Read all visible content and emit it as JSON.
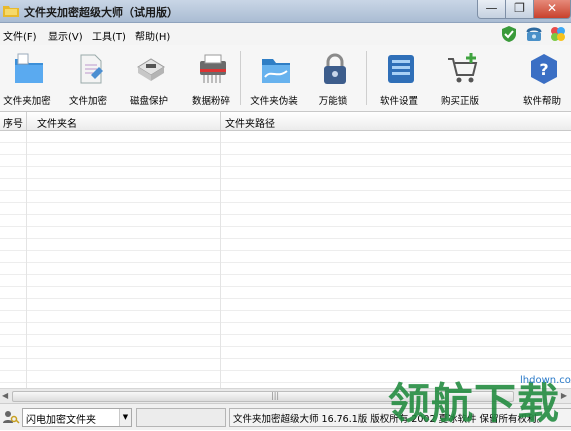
{
  "window": {
    "title": "文件夹加密超级大师（试用版）"
  },
  "menu": {
    "file": "文件(F)",
    "view": "显示(V)",
    "tools": "工具(T)",
    "help": "帮助(H)"
  },
  "toolbar": {
    "items": [
      {
        "label": "文件夹加密",
        "icon": "folder-lock-icon"
      },
      {
        "label": "文件加密",
        "icon": "file-lock-icon"
      },
      {
        "label": "磁盘保护",
        "icon": "disk-protect-icon"
      },
      {
        "label": "数据粉碎",
        "icon": "shredder-icon"
      },
      {
        "label": "文件夹伪装",
        "icon": "folder-disguise-icon"
      },
      {
        "label": "万能锁",
        "icon": "padlock-icon"
      },
      {
        "label": "软件设置",
        "icon": "settings-icon"
      },
      {
        "label": "购买正版",
        "icon": "cart-icon"
      },
      {
        "label": "软件帮助",
        "icon": "help-icon"
      }
    ]
  },
  "list": {
    "columns": [
      "序号",
      "文件夹名",
      "文件夹路径"
    ],
    "rows": []
  },
  "status": {
    "select_value": "闪电加密文件夹",
    "copyright": "文件夹加密超级大师 16.76.1版 版权所有 2002 夏冰软件 保留所有权利。"
  },
  "watermark": {
    "text": "领航下载",
    "url": "lhdown.com"
  },
  "colors": {
    "accent": "#2a7ac9",
    "watermark": "#1f8a3d",
    "close_button": "#c8412d"
  }
}
